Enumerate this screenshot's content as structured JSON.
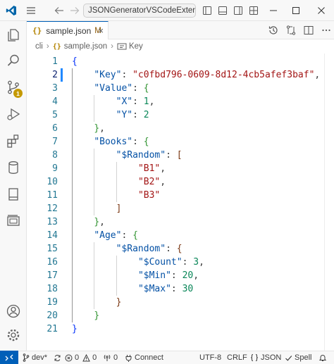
{
  "titlebar": {
    "search_text": "JSONGeneratorVSCodeExtension"
  },
  "activity": {
    "source_control_badge": "1"
  },
  "tab": {
    "icon": "{}",
    "name": "sample.json",
    "modified": "M",
    "close": "×"
  },
  "breadcrumb": {
    "folder": "cli",
    "file_icon": "{}",
    "file": "sample.json",
    "symbol": "Key"
  },
  "editor": {
    "lines": [
      {
        "n": "1",
        "tokens": [
          [
            "b1",
            "{"
          ]
        ]
      },
      {
        "n": "2",
        "tokens": [
          [
            "k",
            "\"Key\""
          ],
          [
            "p",
            ": "
          ],
          [
            "s",
            "\"c0fbd796-0609-8d12-4cb5afef3baf\""
          ],
          [
            "p",
            ","
          ]
        ]
      },
      {
        "n": "3",
        "tokens": [
          [
            "k",
            "\"Value\""
          ],
          [
            "p",
            ": "
          ],
          [
            "b2",
            "{"
          ]
        ]
      },
      {
        "n": "4",
        "tokens": [
          [
            "k",
            "\"X\""
          ],
          [
            "p",
            ": "
          ],
          [
            "n",
            "1"
          ],
          [
            "p",
            ","
          ]
        ]
      },
      {
        "n": "5",
        "tokens": [
          [
            "k",
            "\"Y\""
          ],
          [
            "p",
            ": "
          ],
          [
            "n",
            "2"
          ]
        ]
      },
      {
        "n": "6",
        "tokens": [
          [
            "b2",
            "}"
          ],
          [
            "p",
            ","
          ]
        ]
      },
      {
        "n": "7",
        "tokens": [
          [
            "k",
            "\"Books\""
          ],
          [
            "p",
            ": "
          ],
          [
            "b2",
            "{"
          ]
        ]
      },
      {
        "n": "8",
        "tokens": [
          [
            "k",
            "\"$Random\""
          ],
          [
            "p",
            ": "
          ],
          [
            "b3",
            "["
          ]
        ]
      },
      {
        "n": "9",
        "tokens": [
          [
            "s",
            "\"B1\""
          ],
          [
            "p",
            ","
          ]
        ]
      },
      {
        "n": "10",
        "tokens": [
          [
            "s",
            "\"B2\""
          ],
          [
            "p",
            ","
          ]
        ]
      },
      {
        "n": "11",
        "tokens": [
          [
            "s",
            "\"B3\""
          ]
        ]
      },
      {
        "n": "12",
        "tokens": [
          [
            "b3",
            "]"
          ]
        ]
      },
      {
        "n": "13",
        "tokens": [
          [
            "b2",
            "}"
          ],
          [
            "p",
            ","
          ]
        ]
      },
      {
        "n": "14",
        "tokens": [
          [
            "k",
            "\"Age\""
          ],
          [
            "p",
            ": "
          ],
          [
            "b2",
            "{"
          ]
        ]
      },
      {
        "n": "15",
        "tokens": [
          [
            "k",
            "\"$Random\""
          ],
          [
            "p",
            ": "
          ],
          [
            "b3",
            "{"
          ]
        ]
      },
      {
        "n": "16",
        "tokens": [
          [
            "k",
            "\"$Count\""
          ],
          [
            "p",
            ": "
          ],
          [
            "n",
            "3"
          ],
          [
            "p",
            ","
          ]
        ]
      },
      {
        "n": "17",
        "tokens": [
          [
            "k",
            "\"$Min\""
          ],
          [
            "p",
            ": "
          ],
          [
            "n",
            "20"
          ],
          [
            "p",
            ","
          ]
        ]
      },
      {
        "n": "18",
        "tokens": [
          [
            "k",
            "\"$Max\""
          ],
          [
            "p",
            ": "
          ],
          [
            "n",
            "30"
          ]
        ]
      },
      {
        "n": "19",
        "tokens": [
          [
            "b3",
            "}"
          ]
        ]
      },
      {
        "n": "20",
        "tokens": [
          [
            "b2",
            "}"
          ]
        ]
      },
      {
        "n": "21",
        "tokens": [
          [
            "b1",
            "}"
          ]
        ]
      }
    ],
    "indents": [
      0,
      1,
      1,
      2,
      2,
      1,
      1,
      2,
      3,
      3,
      3,
      2,
      1,
      1,
      2,
      3,
      3,
      3,
      2,
      1,
      0
    ],
    "active_line": 2
  },
  "status": {
    "branch": "dev*",
    "errors": "0",
    "warnings": "0",
    "ports": "0",
    "connect": "Connect",
    "encoding": "UTF-8",
    "eol": "CRLF",
    "language": "JSON",
    "spell": "Spell"
  },
  "colors": {
    "accent": "#005fb8",
    "key": "#0451a5",
    "string": "#a31515",
    "number": "#098658",
    "bracket1": "#0431fa",
    "bracket2": "#319331",
    "bracket3": "#7b3814",
    "badge": "#c59a00"
  }
}
